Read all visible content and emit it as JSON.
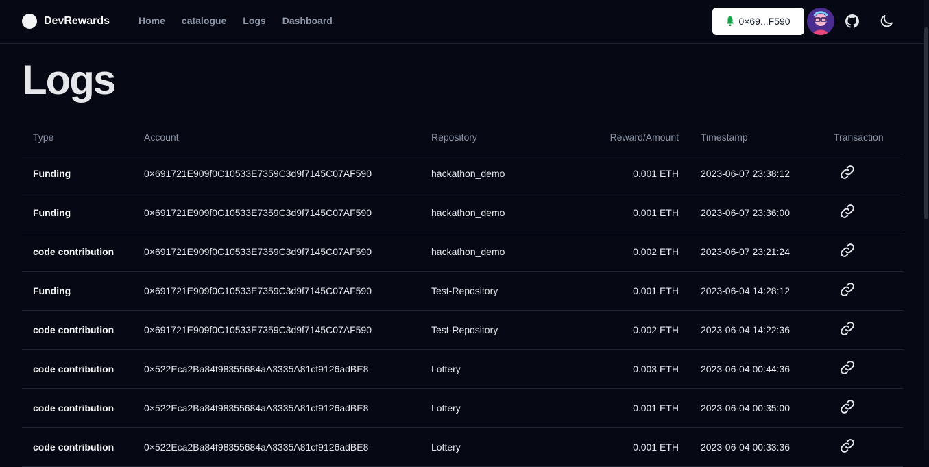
{
  "header": {
    "brand": "DevRewards",
    "nav": [
      "Home",
      "catalogue",
      "Logs",
      "Dashboard"
    ],
    "wallet_label": "0×69...F590"
  },
  "page": {
    "title": "Logs"
  },
  "table": {
    "columns": [
      "Type",
      "Account",
      "Repository",
      "Reward/Amount",
      "Timestamp",
      "Transaction"
    ],
    "rows": [
      {
        "type": "Funding",
        "account": "0×691721E909f0C10533E7359C3d9f7145C07AF590",
        "repository": "hackathon_demo",
        "amount": "0.001 ETH",
        "timestamp": "2023-06-07 23:38:12"
      },
      {
        "type": "Funding",
        "account": "0×691721E909f0C10533E7359C3d9f7145C07AF590",
        "repository": "hackathon_demo",
        "amount": "0.001 ETH",
        "timestamp": "2023-06-07 23:36:00"
      },
      {
        "type": "code contribution",
        "account": "0×691721E909f0C10533E7359C3d9f7145C07AF590",
        "repository": "hackathon_demo",
        "amount": "0.002 ETH",
        "timestamp": "2023-06-07 23:21:24"
      },
      {
        "type": "Funding",
        "account": "0×691721E909f0C10533E7359C3d9f7145C07AF590",
        "repository": "Test-Repository",
        "amount": "0.001 ETH",
        "timestamp": "2023-06-04 14:28:12"
      },
      {
        "type": "code contribution",
        "account": "0×691721E909f0C10533E7359C3d9f7145C07AF590",
        "repository": "Test-Repository",
        "amount": "0.002 ETH",
        "timestamp": "2023-06-04 14:22:36"
      },
      {
        "type": "code contribution",
        "account": "0×522Eca2Ba84f98355684aA3335A81cf9126adBE8",
        "repository": "Lottery",
        "amount": "0.003 ETH",
        "timestamp": "2023-06-04 00:44:36"
      },
      {
        "type": "code contribution",
        "account": "0×522Eca2Ba84f98355684aA3335A81cf9126adBE8",
        "repository": "Lottery",
        "amount": "0.001 ETH",
        "timestamp": "2023-06-04 00:35:00"
      },
      {
        "type": "code contribution",
        "account": "0×522Eca2Ba84f98355684aA3335A81cf9126adBE8",
        "repository": "Lottery",
        "amount": "0.001 ETH",
        "timestamp": "2023-06-04 00:33:36"
      }
    ]
  },
  "icons": {
    "wallet": "bell-icon",
    "github": "github-icon",
    "theme": "moon-icon",
    "transaction": "link-icon"
  },
  "colors": {
    "background": "#060914",
    "muted_text": "#8b93a6",
    "wallet_bell": "#16a34a"
  }
}
